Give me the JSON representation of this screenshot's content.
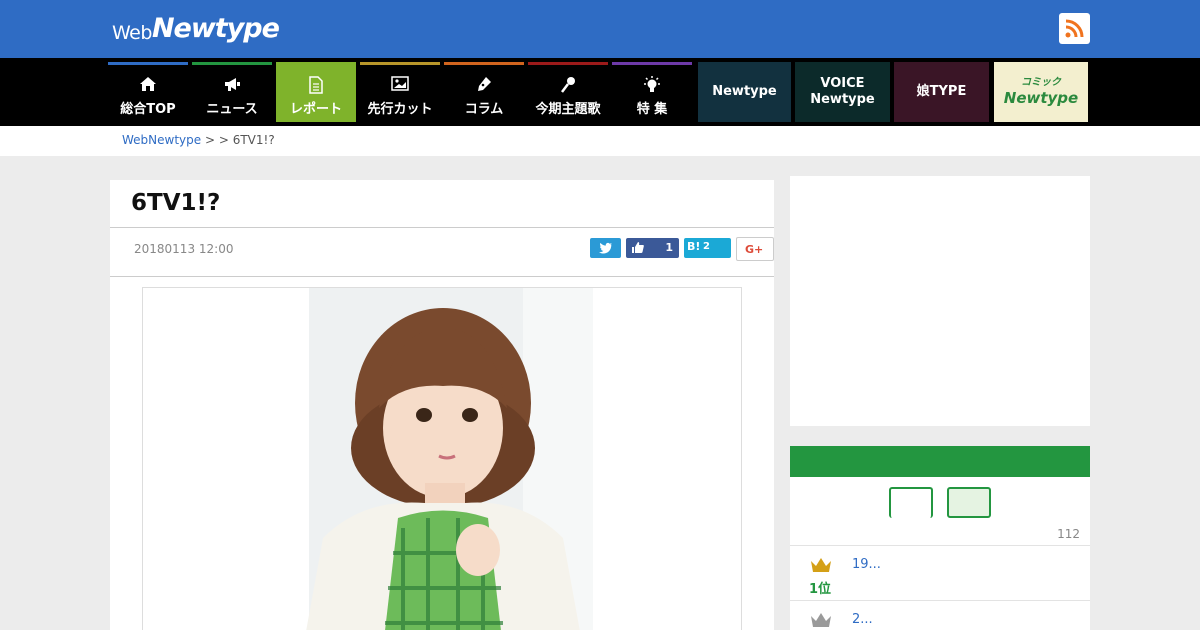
{
  "header": {
    "logo_small": "Web",
    "logo_big": "Newtype",
    "rss_icon": "rss-icon"
  },
  "nav": {
    "items": [
      {
        "label": "総合TOP",
        "icon": "home-icon",
        "bar_color": "#2f6cc4",
        "active": false
      },
      {
        "label": "ニュース",
        "icon": "megaphone-icon",
        "bar_color": "#239640",
        "active": false
      },
      {
        "label": "レポート",
        "icon": "document-icon",
        "bar_color": "#7fb32b",
        "active": true
      },
      {
        "label": "先行カット",
        "icon": "image-icon",
        "bar_color": "#b8962a",
        "active": false
      },
      {
        "label": "コラム",
        "icon": "pen-icon",
        "bar_color": "#d0641e",
        "active": false
      },
      {
        "label": "今期主題歌",
        "icon": "microphone-icon",
        "bar_color": "#9c1a1a",
        "active": false
      },
      {
        "label": "特 集",
        "icon": "lightbulb-icon",
        "bar_color": "#6e3aa8",
        "active": false
      }
    ],
    "banners": [
      {
        "line1": "Newtype",
        "line2": "",
        "bg": "#12313f"
      },
      {
        "line1": "VOICE",
        "line2": "Newtype",
        "bg": "#0c2a2a"
      },
      {
        "line1": "娘TYPE",
        "line2": "",
        "bg": "#3a1526"
      },
      {
        "line1": "コミック",
        "line2": "Newtype",
        "bg": "#f3efcf"
      }
    ]
  },
  "breadcrumb": {
    "home": "WebNewtype",
    "sep1": " > ",
    "sep2": " > ",
    "current": "6TV1!?"
  },
  "article": {
    "title": "6TV1!?",
    "date": "20180113 12:00",
    "share": {
      "twitter_icon": "twitter-icon",
      "like_count": "1",
      "hatena_label": "B!",
      "hatena_count": "2",
      "gplus_label": "G+"
    },
    "image_alt": "photo"
  },
  "sidebar": {
    "ranking": {
      "count": "112",
      "items": [
        {
          "rank": "1位",
          "text": "19..."
        },
        {
          "rank": "",
          "text": "2..."
        }
      ]
    }
  },
  "colors": {
    "brand_blue": "#2f6cc4",
    "report_green": "#7fb32b",
    "ranking_green": "#239640"
  }
}
